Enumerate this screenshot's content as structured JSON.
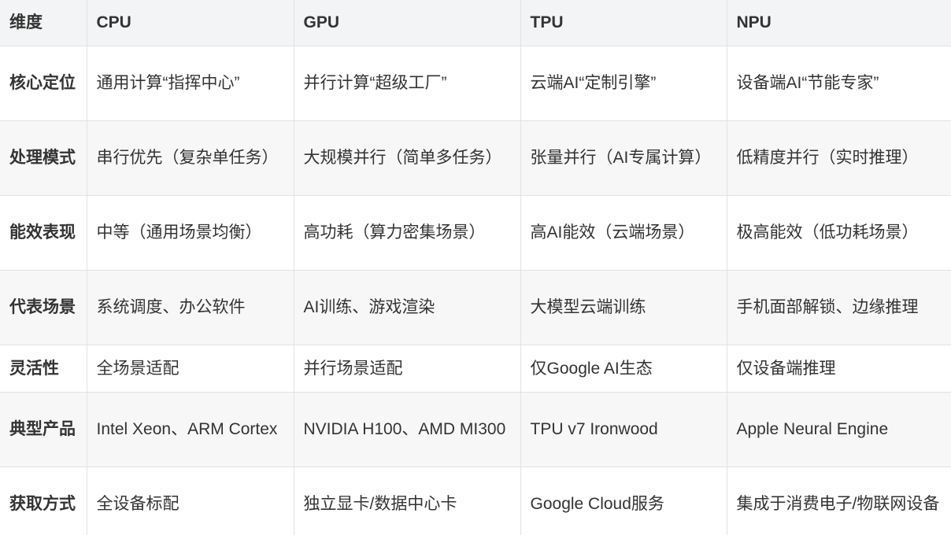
{
  "header": [
    "维度",
    "CPU",
    "GPU",
    "TPU",
    "NPU"
  ],
  "rows": [
    {
      "label": "核心定位",
      "cells": [
        "通用计算“指挥中心”",
        "并行计算“超级工厂”",
        "云端AI“定制引擎”",
        "设备端AI“节能专家”"
      ]
    },
    {
      "label": "处理模式",
      "cells": [
        "串行优先（复杂单任务）",
        "大规模并行（简单多任务）",
        "张量并行（AI专属计算）",
        "低精度并行（实时推理）"
      ]
    },
    {
      "label": "能效表现",
      "cells": [
        "中等（通用场景均衡）",
        "高功耗（算力密集场景）",
        "高AI能效（云端场景）",
        "极高能效（低功耗场景）"
      ]
    },
    {
      "label": "代表场景",
      "cells": [
        "系统调度、办公软件",
        "AI训练、游戏渲染",
        "大模型云端训练",
        "手机面部解锁、边缘推理"
      ]
    },
    {
      "label": "灵活性",
      "cells": [
        "全场景适配",
        "并行场景适配",
        "仅Google AI生态",
        "仅设备端推理"
      ]
    },
    {
      "label": "典型产品",
      "cells": [
        "Intel Xeon、ARM Cortex",
        "NVIDIA H100、AMD MI300",
        "TPU v7 Ironwood",
        "Apple Neural Engine"
      ]
    },
    {
      "label": "获取方式",
      "cells": [
        "全设备标配",
        "独立显卡/数据中心卡",
        "Google Cloud服务",
        "集成于消费电子/物联网设备"
      ]
    }
  ]
}
